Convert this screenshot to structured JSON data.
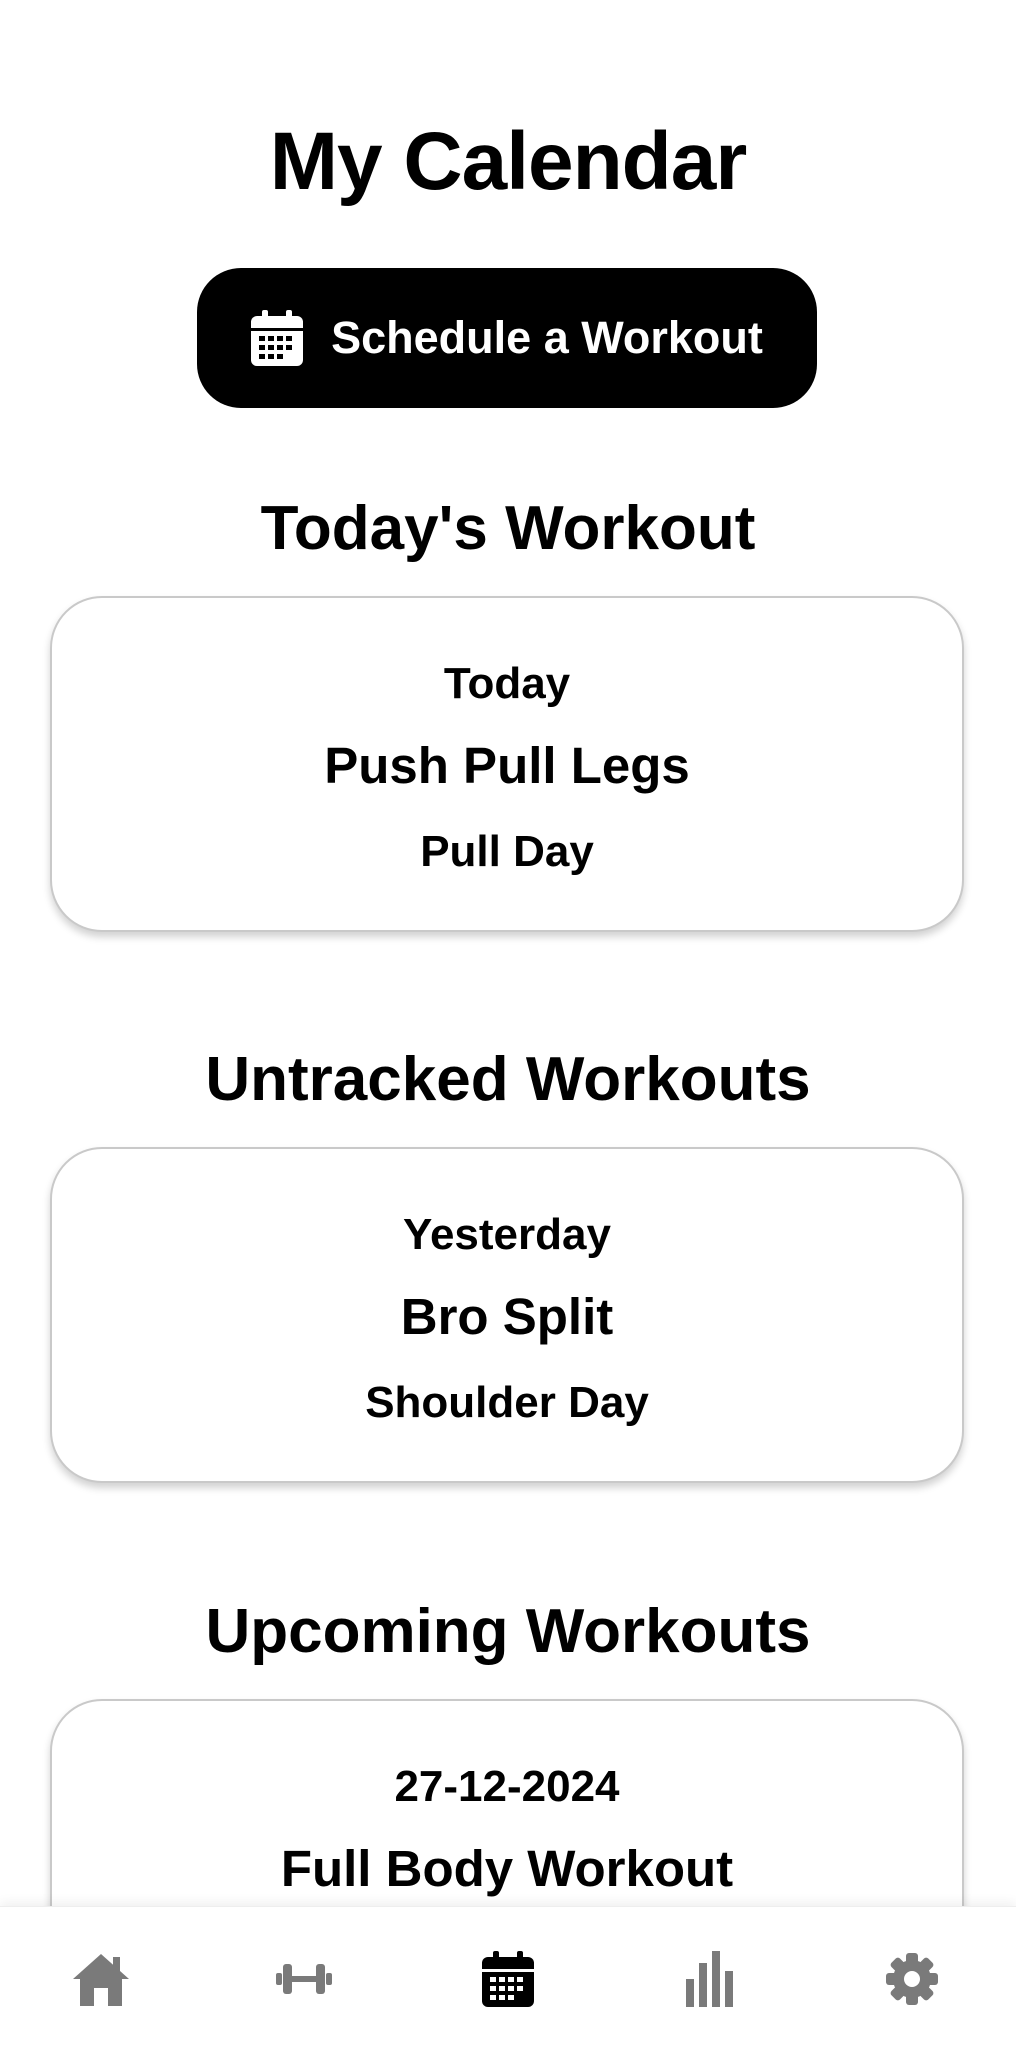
{
  "page": {
    "title": "My Calendar"
  },
  "schedule_button": {
    "label": "Schedule a Workout",
    "icon": "calendar-icon"
  },
  "sections": {
    "today": {
      "title": "Today's Workout",
      "cards": [
        {
          "when": "Today",
          "program": "Push Pull Legs",
          "day": "Pull Day"
        }
      ]
    },
    "untracked": {
      "title": "Untracked Workouts",
      "cards": [
        {
          "when": "Yesterday",
          "program": "Bro Split",
          "day": "Shoulder Day"
        }
      ]
    },
    "upcoming": {
      "title": "Upcoming Workouts",
      "cards": [
        {
          "when": "27-12-2024",
          "program": "Full Body Workout",
          "day": ""
        }
      ]
    }
  },
  "bottom_nav": {
    "items": [
      {
        "icon": "home-icon",
        "active": false
      },
      {
        "icon": "dumbbell-icon",
        "active": false
      },
      {
        "icon": "calendar-icon",
        "active": true
      },
      {
        "icon": "bar-chart-icon",
        "active": false
      },
      {
        "icon": "gear-icon",
        "active": false
      }
    ],
    "active_color": "#000000",
    "inactive_color": "#7a7a7a"
  },
  "colors": {
    "background": "#ffffff",
    "primary": "#000000",
    "card_border": "#c9c9c9"
  }
}
